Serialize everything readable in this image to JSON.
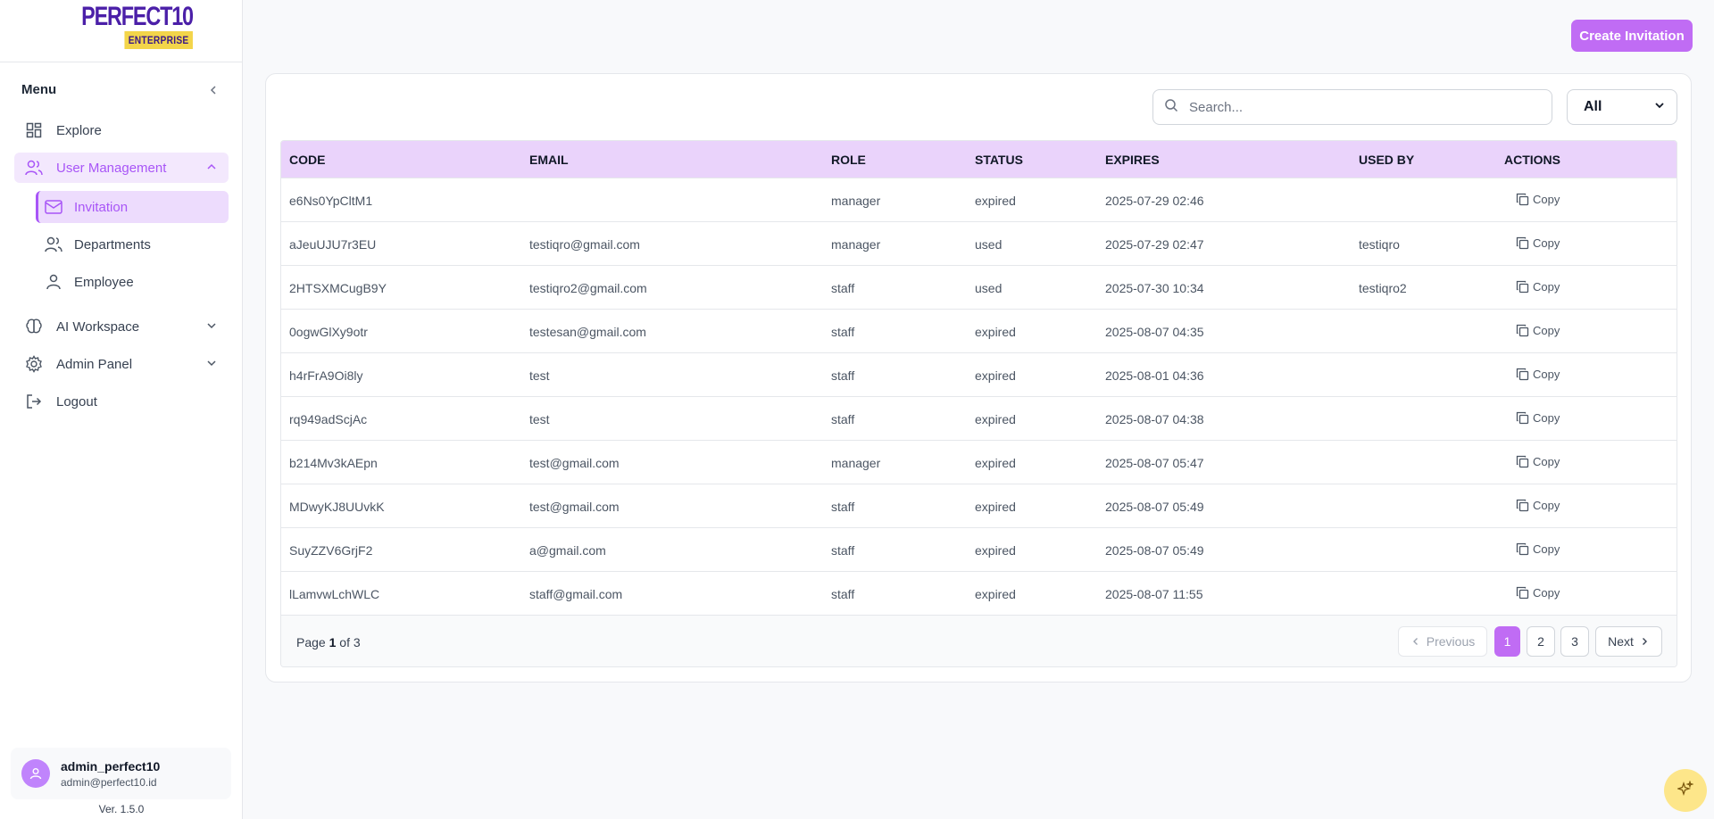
{
  "brand": {
    "name": "PERFECT10",
    "sub": "ENTERPRISE"
  },
  "sidebar": {
    "menu_label": "Menu",
    "items": [
      {
        "label": "Explore"
      },
      {
        "label": "User Management"
      },
      {
        "label": "AI Workspace"
      },
      {
        "label": "Admin Panel"
      },
      {
        "label": "Logout"
      }
    ],
    "sub_items": [
      {
        "label": "Invitation"
      },
      {
        "label": "Departments"
      },
      {
        "label": "Employee"
      }
    ],
    "user": {
      "name": "admin_perfect10",
      "email": "admin@perfect10.id"
    },
    "version": "Ver. 1.5.0"
  },
  "header": {
    "create_label": "Create Invitation"
  },
  "search": {
    "placeholder": "Search..."
  },
  "filter": {
    "value": "All"
  },
  "table": {
    "columns": [
      "CODE",
      "EMAIL",
      "ROLE",
      "STATUS",
      "EXPIRES",
      "USED BY",
      "ACTIONS"
    ],
    "copy_label": "Copy",
    "rows": [
      {
        "code": "e6Ns0YpCltM1",
        "email": "",
        "role": "manager",
        "status": "expired",
        "expires": "2025-07-29 02:46",
        "used_by": ""
      },
      {
        "code": "aJeuUJU7r3EU",
        "email": "testiqro@gmail.com",
        "role": "manager",
        "status": "used",
        "expires": "2025-07-29 02:47",
        "used_by": "testiqro"
      },
      {
        "code": "2HTSXMCugB9Y",
        "email": "testiqro2@gmail.com",
        "role": "staff",
        "status": "used",
        "expires": "2025-07-30 10:34",
        "used_by": "testiqro2"
      },
      {
        "code": "0ogwGlXy9otr",
        "email": "testesan@gmail.com",
        "role": "staff",
        "status": "expired",
        "expires": "2025-08-07 04:35",
        "used_by": ""
      },
      {
        "code": "h4rFrA9Oi8ly",
        "email": "test",
        "role": "staff",
        "status": "expired",
        "expires": "2025-08-01 04:36",
        "used_by": ""
      },
      {
        "code": "rq949adScjAc",
        "email": "test",
        "role": "staff",
        "status": "expired",
        "expires": "2025-08-07 04:38",
        "used_by": ""
      },
      {
        "code": "b214Mv3kAEpn",
        "email": "test@gmail.com",
        "role": "manager",
        "status": "expired",
        "expires": "2025-08-07 05:47",
        "used_by": ""
      },
      {
        "code": "MDwyKJ8UUvkK",
        "email": "test@gmail.com",
        "role": "staff",
        "status": "expired",
        "expires": "2025-08-07 05:49",
        "used_by": ""
      },
      {
        "code": "SuyZZV6GrjF2",
        "email": "a@gmail.com",
        "role": "staff",
        "status": "expired",
        "expires": "2025-08-07 05:49",
        "used_by": ""
      },
      {
        "code": "lLamvwLchWLC",
        "email": "staff@gmail.com",
        "role": "staff",
        "status": "expired",
        "expires": "2025-08-07 11:55",
        "used_by": ""
      }
    ]
  },
  "pagination": {
    "page_word": "Page",
    "current": "1",
    "of_word": "of",
    "total": "3",
    "previous_label": "Previous",
    "next_label": "Next",
    "pages": [
      "1",
      "2",
      "3"
    ]
  },
  "colors": {
    "accent": "#c06cf4",
    "header_bg": "#ead3fb",
    "active_bg": "#f3e8fd"
  }
}
